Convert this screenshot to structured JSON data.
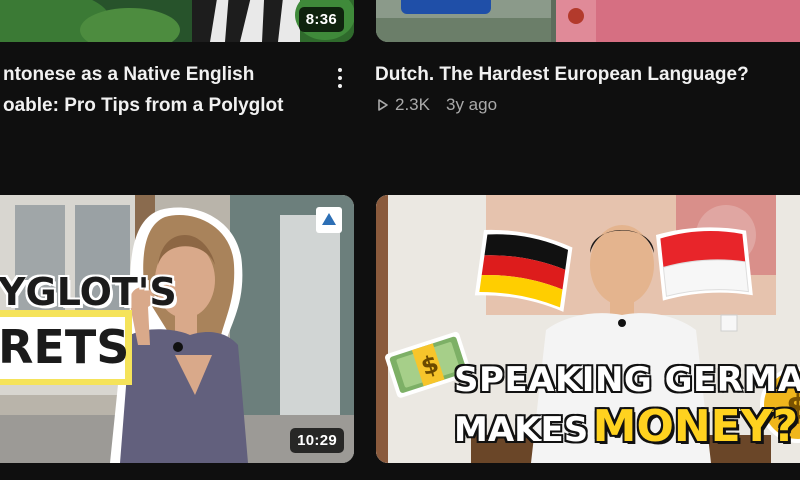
{
  "videos": [
    {
      "title_line1": "ntonese as a Native English",
      "title_line2": "oable: Pro Tips from a Polyglot",
      "duration": "8:36",
      "icon": "more-vertical-icon"
    },
    {
      "title_line1": "Dutch. The Hardest European Language?",
      "views": "2.3K",
      "age": "3y ago",
      "icon": "play-outline-icon"
    },
    {
      "duration": "10:29",
      "overlay_line1": "YGLOT'S",
      "overlay_line2": "RETS",
      "thumbnail_subject": "woman-pointing-to-head"
    },
    {
      "overlay_line1": "SPEAKING GERMAN",
      "overlay_line2a": "MAKES",
      "overlay_line2b": "MONEY?",
      "thumbnail_subject": "man-with-german-and-indonesian-flags"
    }
  ],
  "colors": {
    "background": "#0f0f0f",
    "title": "#f1f1f1",
    "meta": "#aaaaaa",
    "money_yellow": "#ffd21f"
  }
}
